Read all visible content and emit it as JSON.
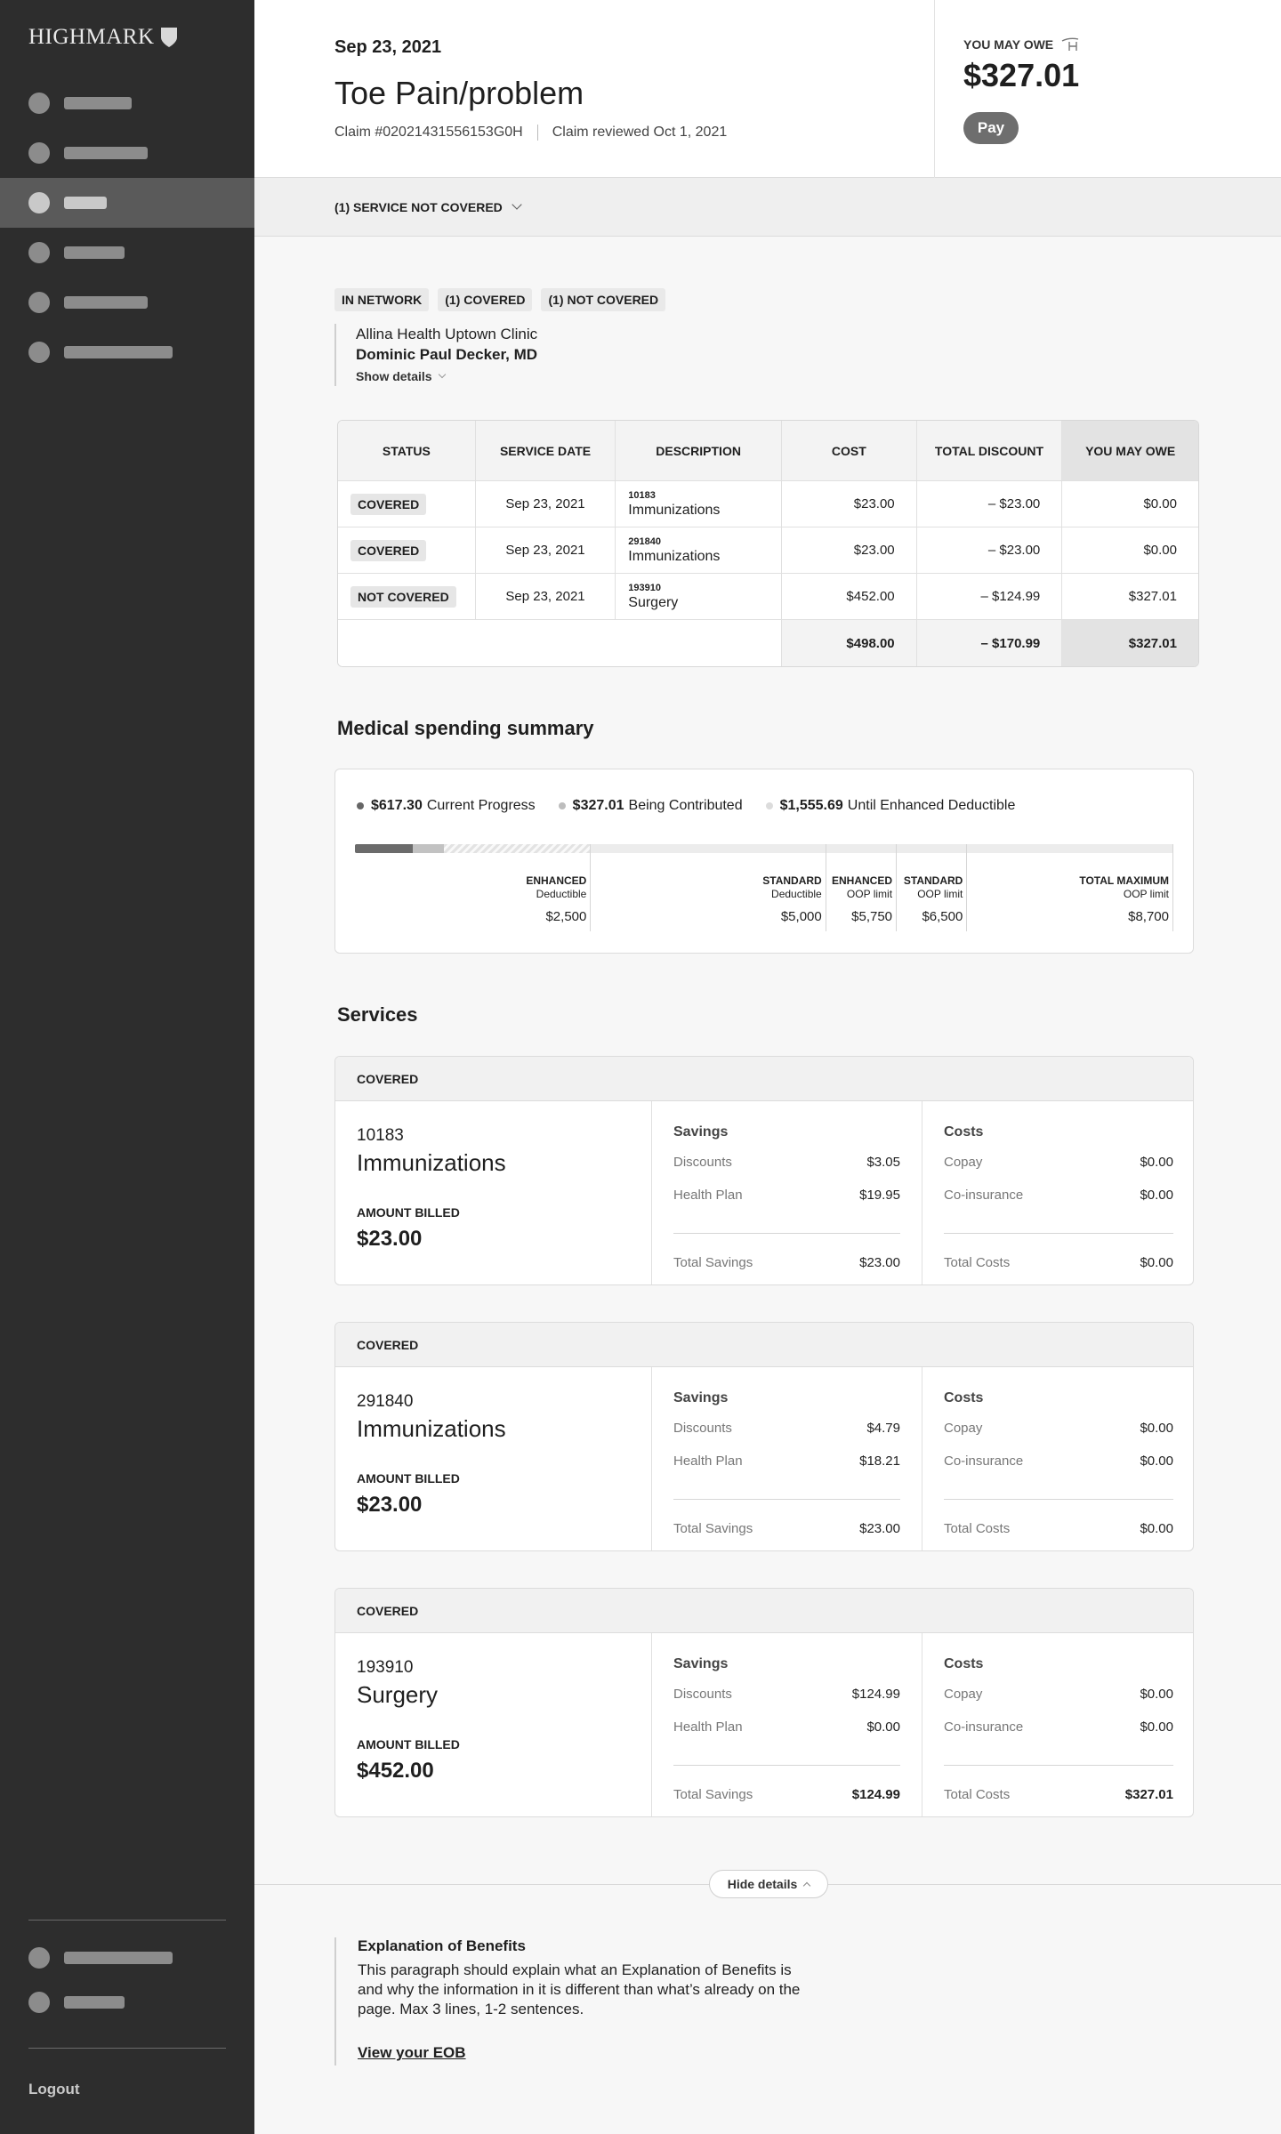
{
  "app": {
    "logo_text": "HIGHMARK",
    "logout_label": "Logout"
  },
  "header": {
    "date": "Sep 23, 2021",
    "title": "Toe Pain/problem",
    "claim_label": "Claim",
    "claim_number": "#02021431556153G0H",
    "reviewed": "Claim reviewed Oct 1, 2021",
    "owe_label": "YOU MAY OWE",
    "owe_amount": "$327.01",
    "pay_label": "Pay"
  },
  "not_covered_bar": {
    "label": "(1) SERVICE NOT COVERED"
  },
  "badges": [
    "IN NETWORK",
    "(1) COVERED",
    "(1) NOT COVERED"
  ],
  "provider": {
    "clinic": "Allina Health Uptown Clinic",
    "doctor": "Dominic Paul Decker, MD",
    "show_details": "Show details"
  },
  "table": {
    "headers": [
      "STATUS",
      "SERVICE DATE",
      "DESCRIPTION",
      "COST",
      "TOTAL DISCOUNT",
      "YOU MAY OWE"
    ],
    "rows": [
      {
        "status": "COVERED",
        "date": "Sep 23, 2021",
        "code": "10183",
        "name": "Immunizations",
        "cost": "$23.00",
        "discount": "– $23.00",
        "owe": "$0.00"
      },
      {
        "status": "COVERED",
        "date": "Sep 23, 2021",
        "code": "291840",
        "name": "Immunizations",
        "cost": "$23.00",
        "discount": "– $23.00",
        "owe": "$0.00"
      },
      {
        "status": "NOT COVERED",
        "date": "Sep 23, 2021",
        "code": "193910",
        "name": "Surgery",
        "cost": "$452.00",
        "discount": "– $124.99",
        "owe": "$327.01"
      }
    ],
    "totals": {
      "cost": "$498.00",
      "discount": "– $170.99",
      "owe": "$327.01"
    }
  },
  "spending": {
    "title": "Medical spending summary",
    "legend": [
      {
        "amount": "$617.30",
        "label": "Current Progress",
        "color": "#666666"
      },
      {
        "amount": "$327.01",
        "label": "Being Contributed",
        "color": "#bdbdbd"
      },
      {
        "amount": "$1,555.69",
        "label": "Until Enhanced Deductible",
        "color": "#dddddd"
      }
    ],
    "total_max": 8700,
    "progress_value": 617.3,
    "contributing_value": 327.01,
    "remaining_value": 1555.69,
    "milestones": [
      {
        "t1": "ENHANCED",
        "t2": "Deductible",
        "amount": "$2,500",
        "value": 2500
      },
      {
        "t1": "STANDARD",
        "t2": "Deductible",
        "amount": "$5,000",
        "value": 5000
      },
      {
        "t1": "ENHANCED",
        "t2": "OOP limit",
        "amount": "$5,750",
        "value": 5750
      },
      {
        "t1": "STANDARD",
        "t2": "OOP limit",
        "amount": "$6,500",
        "value": 6500
      },
      {
        "t1": "TOTAL MAXIMUM",
        "t2": "OOP limit",
        "amount": "$8,700",
        "value": 8700
      }
    ]
  },
  "services": {
    "title": "Services",
    "amount_billed_label": "AMOUNT BILLED",
    "savings_label": "Savings",
    "costs_label": "Costs",
    "discounts_label": "Discounts",
    "health_plan_label": "Health Plan",
    "total_savings_label": "Total Savings",
    "copay_label": "Copay",
    "coinsurance_label": "Co-insurance",
    "total_costs_label": "Total Costs",
    "items": [
      {
        "status": "COVERED",
        "code": "10183",
        "name": "Immunizations",
        "billed": "$23.00",
        "discounts": "$3.05",
        "health_plan": "$19.95",
        "total_savings": "$23.00",
        "copay": "$0.00",
        "coinsurance": "$0.00",
        "total_costs": "$0.00"
      },
      {
        "status": "COVERED",
        "code": "291840",
        "name": "Immunizations",
        "billed": "$23.00",
        "discounts": "$4.79",
        "health_plan": "$18.21",
        "total_savings": "$23.00",
        "copay": "$0.00",
        "coinsurance": "$0.00",
        "total_costs": "$0.00"
      },
      {
        "status": "COVERED",
        "code": "193910",
        "name": "Surgery",
        "billed": "$452.00",
        "discounts": "$124.99",
        "health_plan": "$0.00",
        "total_savings": "$124.99",
        "copay": "$0.00",
        "coinsurance": "$0.00",
        "total_costs": "$327.01"
      }
    ]
  },
  "footer": {
    "hide_details": "Hide details",
    "eob_title": "Explanation of Benefits",
    "eob_text": "This paragraph should explain what an Explanation of Benefits is and why the information in it is different than what’s already on the page. Max 3 lines, 1-2 sentences.",
    "eob_link": "View your EOB"
  }
}
